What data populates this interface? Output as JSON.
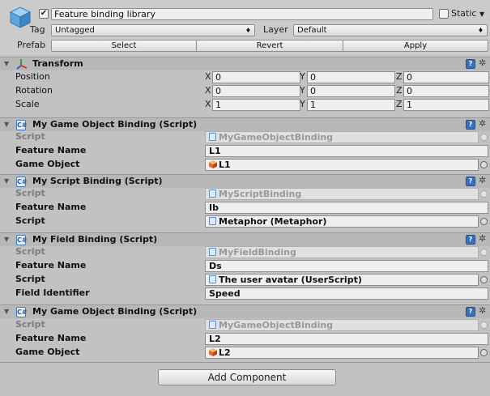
{
  "header": {
    "active_checked": "✔",
    "object_name": "Feature binding library",
    "static_label": "Static",
    "tag_label": "Tag",
    "tag_value": "Untagged",
    "layer_label": "Layer",
    "layer_value": "Default",
    "prefab_label": "Prefab",
    "select_label": "Select",
    "revert_label": "Revert",
    "apply_label": "Apply"
  },
  "transform": {
    "title": "Transform",
    "rows": [
      {
        "label": "Position",
        "x": "0",
        "y": "0",
        "z": "0"
      },
      {
        "label": "Rotation",
        "x": "0",
        "y": "0",
        "z": "0"
      },
      {
        "label": "Scale",
        "x": "1",
        "y": "1",
        "z": "1"
      }
    ],
    "axis_x": "X",
    "axis_y": "Y",
    "axis_z": "Z"
  },
  "components": [
    {
      "title": "My Game Object Binding (Script)",
      "script_label": "Script",
      "script_value": "MyGameObjectBinding",
      "fields": [
        {
          "label": "Feature Name",
          "value": "L1"
        },
        {
          "label": "Game Object",
          "value": "L1"
        }
      ]
    },
    {
      "title": "My Script Binding (Script)",
      "script_label": "Script",
      "script_value": "MyScriptBinding",
      "fields": [
        {
          "label": "Feature Name",
          "value": "Ib"
        },
        {
          "label": "Script",
          "value": "Metaphor (Metaphor)"
        }
      ]
    },
    {
      "title": "My Field Binding (Script)",
      "script_label": "Script",
      "script_value": "MyFieldBinding",
      "fields": [
        {
          "label": "Feature Name",
          "value": "Ds"
        },
        {
          "label": "Script",
          "value": "The user avatar (UserScript)"
        },
        {
          "label": "Field Identifier",
          "value": "Speed"
        }
      ]
    },
    {
      "title": "My Game Object Binding (Script)",
      "script_label": "Script",
      "script_value": "MyGameObjectBinding",
      "fields": [
        {
          "label": "Feature Name",
          "value": "L2"
        },
        {
          "label": "Game Object",
          "value": "L2"
        }
      ]
    }
  ],
  "add_component_label": "Add Component",
  "icons": {
    "object": "cube-icon",
    "transform": "axes-icon",
    "script": "script-icon",
    "help": "book-icon",
    "settings": "gear-icon",
    "picker": "object-picker-icon"
  }
}
